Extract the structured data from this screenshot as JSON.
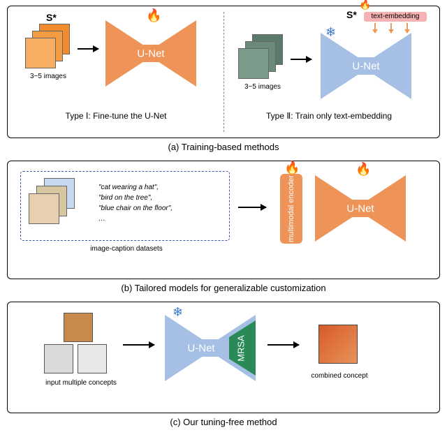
{
  "captions": {
    "a": "(a) Training-based methods",
    "b": "(b) Tailored models for generalizable customization",
    "c": "(c) Our tuning-free method"
  },
  "panelA": {
    "s_star": "S*",
    "img_caption": "3~5 images",
    "unet_label": "U-Net",
    "type1": "Type Ⅰ: Fine-tune the U-Net",
    "type2": "Type Ⅱ: Train only text-embedding",
    "text_embedding": "text-embedding"
  },
  "panelB": {
    "caption_lines": [
      "\"cat wearing a hat\",",
      "\"bird on the tree\",",
      "\"blue chair on the floor\",",
      "…"
    ],
    "dataset_label": "image-caption datasets",
    "mm_encoder": "multimodal encoder",
    "unet_label": "U-Net"
  },
  "panelC": {
    "input_label": "input multiple concepts",
    "unet_label": "U-Net",
    "mrsa": "MRSA",
    "output_label": "combined concept"
  },
  "icons": {
    "fire": "🔥",
    "snow": "❄"
  }
}
